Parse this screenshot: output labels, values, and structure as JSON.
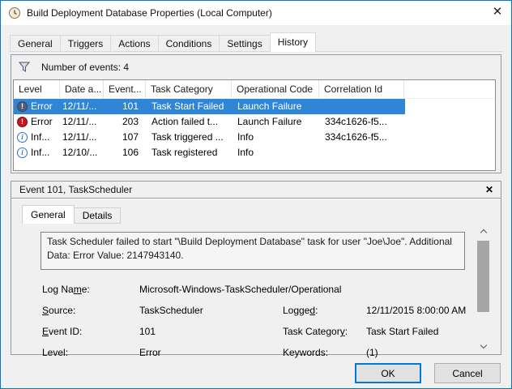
{
  "window": {
    "title": "Build Deployment Database Properties (Local Computer)",
    "close_glyph": "✕"
  },
  "tabs": [
    "General",
    "Triggers",
    "Actions",
    "Conditions",
    "Settings",
    "History"
  ],
  "active_tab": "History",
  "events": {
    "count_label": "Number of events: 4",
    "columns": [
      "Level",
      "Date a...",
      "Event...",
      "Task Category",
      "Operational Code",
      "Correlation Id"
    ],
    "rows": [
      {
        "level": "Error",
        "icon": "error",
        "date": "12/11/...",
        "event": "101",
        "category": "Task Start Failed",
        "opcode": "Launch Failure",
        "correlation": "",
        "selected": true
      },
      {
        "level": "Error",
        "icon": "error",
        "date": "12/11/...",
        "event": "203",
        "category": "Action failed t...",
        "opcode": "Launch Failure",
        "correlation": "334c1626-f5...",
        "selected": false
      },
      {
        "level": "Inf...",
        "icon": "info",
        "date": "12/11/...",
        "event": "107",
        "category": "Task triggered ...",
        "opcode": "Info",
        "correlation": "334c1626-f5...",
        "selected": false
      },
      {
        "level": "Inf...",
        "icon": "info",
        "date": "12/10/...",
        "event": "106",
        "category": "Task registered",
        "opcode": "Info",
        "correlation": "",
        "selected": false
      }
    ]
  },
  "icons": {
    "error_glyph": "!",
    "info_glyph": "i"
  },
  "preview": {
    "title": "Event 101, TaskScheduler",
    "close_glyph": "✕",
    "tabs": [
      "General",
      "Details"
    ],
    "active_tab": "General",
    "message": "Task Scheduler failed to start \"\\Build Deployment Database\" task for user \"Joe\\Joe\". Additional Data: Error Value: 2147943140.",
    "details": {
      "log_name": {
        "pre": "Log Na",
        "key": "m",
        "post": "e:",
        "value": "Microsoft-Windows-TaskScheduler/Operational"
      },
      "source": {
        "pre": "",
        "key": "S",
        "post": "ource:",
        "value": "TaskScheduler"
      },
      "logged": {
        "pre": "Logge",
        "key": "d",
        "post": ":",
        "value": "12/11/2015 8:00:00 AM"
      },
      "event_id": {
        "pre": "",
        "key": "E",
        "post": "vent ID:",
        "value": "101"
      },
      "task_category": {
        "pre": "Task Categor",
        "key": "y",
        "post": ":",
        "value": "Task Start Failed"
      },
      "level": {
        "pre": "Level:",
        "key": "",
        "post": "",
        "value": "Error"
      },
      "keywords": {
        "pre": "Keywords:",
        "key": "",
        "post": "",
        "value": "(1)"
      }
    }
  },
  "buttons": {
    "ok": "OK",
    "cancel": "Cancel"
  },
  "colors": {
    "accent": "#0078d7",
    "sel": "#2f86d7",
    "err": "#c4161c",
    "info": "#2e74c9",
    "dim": "#4f5d78"
  }
}
